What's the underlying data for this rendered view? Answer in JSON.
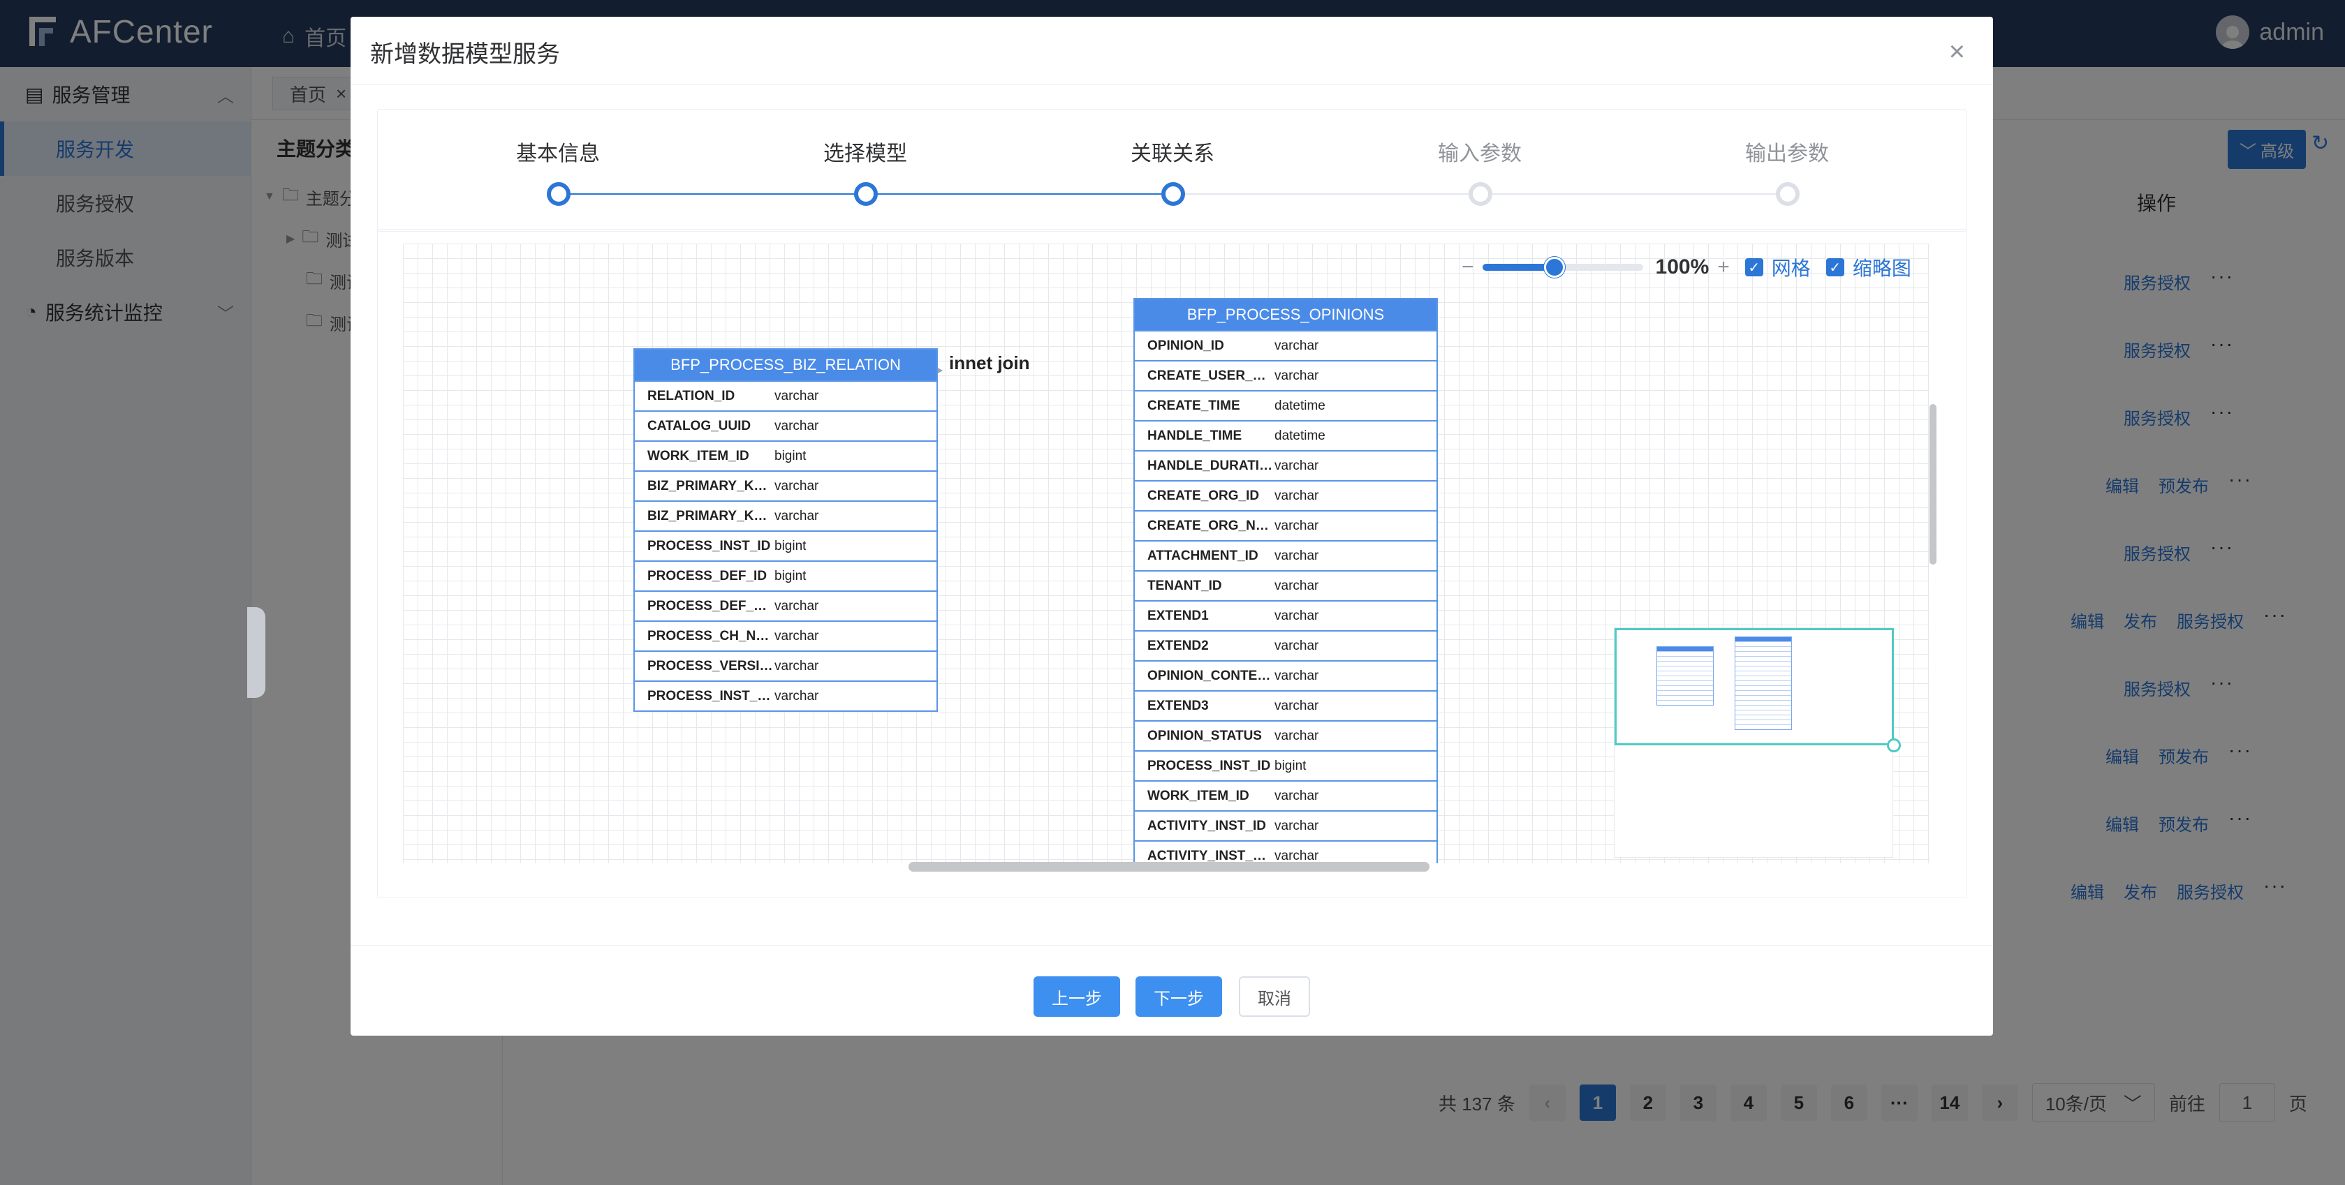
{
  "app": {
    "title": "AFCenter",
    "home_nav": "首页",
    "user": "admin"
  },
  "sidebar": {
    "group1": "服务管理",
    "items": [
      "服务开发",
      "服务授权",
      "服务版本"
    ],
    "group2": "服务统计监控"
  },
  "tabs": {
    "home": "首页",
    "close": "×"
  },
  "tree": {
    "title": "主题分类",
    "root": "主题分",
    "children": [
      "测试",
      "测试",
      "测试"
    ]
  },
  "content": {
    "advanced_button": "高级",
    "ops_header": "操作",
    "rows": [
      [
        "服务授权"
      ],
      [
        "服务授权"
      ],
      [
        "服务授权"
      ],
      [
        "编辑",
        "预发布"
      ],
      [
        "服务授权"
      ],
      [
        "编辑",
        "发布",
        "服务授权"
      ],
      [
        "服务授权"
      ],
      [
        "编辑",
        "预发布"
      ],
      [
        "编辑",
        "预发布"
      ],
      [
        "编辑",
        "发布",
        "服务授权"
      ]
    ],
    "more": "···"
  },
  "pagination": {
    "total": "共 137 条",
    "prev": "‹",
    "pages": [
      "1",
      "2",
      "3",
      "4",
      "5",
      "6",
      "···",
      "14"
    ],
    "next": "›",
    "page_size": "10条/页",
    "goto_label": "前往",
    "goto_value": "1",
    "page_unit": "页"
  },
  "modal": {
    "title": "新增数据模型服务",
    "close": "×",
    "steps": [
      {
        "label": "基本信息",
        "status": "done"
      },
      {
        "label": "选择模型",
        "status": "done"
      },
      {
        "label": "关联关系",
        "status": "current"
      },
      {
        "label": "输入参数",
        "status": "pending"
      },
      {
        "label": "输出参数",
        "status": "pending"
      }
    ],
    "toolbar": {
      "zoom_minus": "−",
      "zoom_plus": "+",
      "zoom_level": "100%",
      "zoom_fraction": 0.45,
      "grid_label": "网格",
      "grid_checked": true,
      "minimap_label": "缩略图",
      "minimap_checked": true
    },
    "join_label": "innet join",
    "left_table": {
      "name": "BFP_PROCESS_BIZ_RELATION",
      "fields": [
        {
          "name": "RELATION_ID",
          "type": "varchar"
        },
        {
          "name": "CATALOG_UUID",
          "type": "varchar"
        },
        {
          "name": "WORK_ITEM_ID",
          "type": "bigint"
        },
        {
          "name": "BIZ_PRIMARY_KEY...",
          "type": "varchar"
        },
        {
          "name": "BIZ_PRIMARY_KEY...",
          "type": "varchar"
        },
        {
          "name": "PROCESS_INST_ID",
          "type": "bigint"
        },
        {
          "name": "PROCESS_DEF_ID",
          "type": "bigint"
        },
        {
          "name": "PROCESS_DEF_NA...",
          "type": "varchar"
        },
        {
          "name": "PROCESS_CH_NAME",
          "type": "varchar"
        },
        {
          "name": "PROCESS_VERSION",
          "type": "varchar"
        },
        {
          "name": "PROCESS_INST_N...",
          "type": "varchar"
        }
      ]
    },
    "right_table": {
      "name": "BFP_PROCESS_OPINIONS",
      "fields": [
        {
          "name": "OPINION_ID",
          "type": "varchar"
        },
        {
          "name": "CREATE_USER_NA...",
          "type": "varchar"
        },
        {
          "name": "CREATE_TIME",
          "type": "datetime"
        },
        {
          "name": "HANDLE_TIME",
          "type": "datetime"
        },
        {
          "name": "HANDLE_DURATION",
          "type": "varchar"
        },
        {
          "name": "CREATE_ORG_ID",
          "type": "varchar"
        },
        {
          "name": "CREATE_ORG_NAME",
          "type": "varchar"
        },
        {
          "name": "ATTACHMENT_ID",
          "type": "varchar"
        },
        {
          "name": "TENANT_ID",
          "type": "varchar"
        },
        {
          "name": "EXTEND1",
          "type": "varchar"
        },
        {
          "name": "EXTEND2",
          "type": "varchar"
        },
        {
          "name": "OPINION_CONTENT",
          "type": "varchar"
        },
        {
          "name": "EXTEND3",
          "type": "varchar"
        },
        {
          "name": "OPINION_STATUS",
          "type": "varchar"
        },
        {
          "name": "PROCESS_INST_ID",
          "type": "bigint"
        },
        {
          "name": "WORK_ITEM_ID",
          "type": "varchar"
        },
        {
          "name": "ACTIVITY_INST_ID",
          "type": "varchar"
        },
        {
          "name": "ACTIVITY_INST_NA...",
          "type": "varchar"
        }
      ]
    },
    "buttons": {
      "prev": "上一步",
      "next": "下一步",
      "cancel": "取消"
    }
  },
  "colors": {
    "primary": "#2b76d6",
    "header": "#243c5e",
    "table_head": "#4a8be8",
    "minimap_frame": "#4ecbc4"
  }
}
